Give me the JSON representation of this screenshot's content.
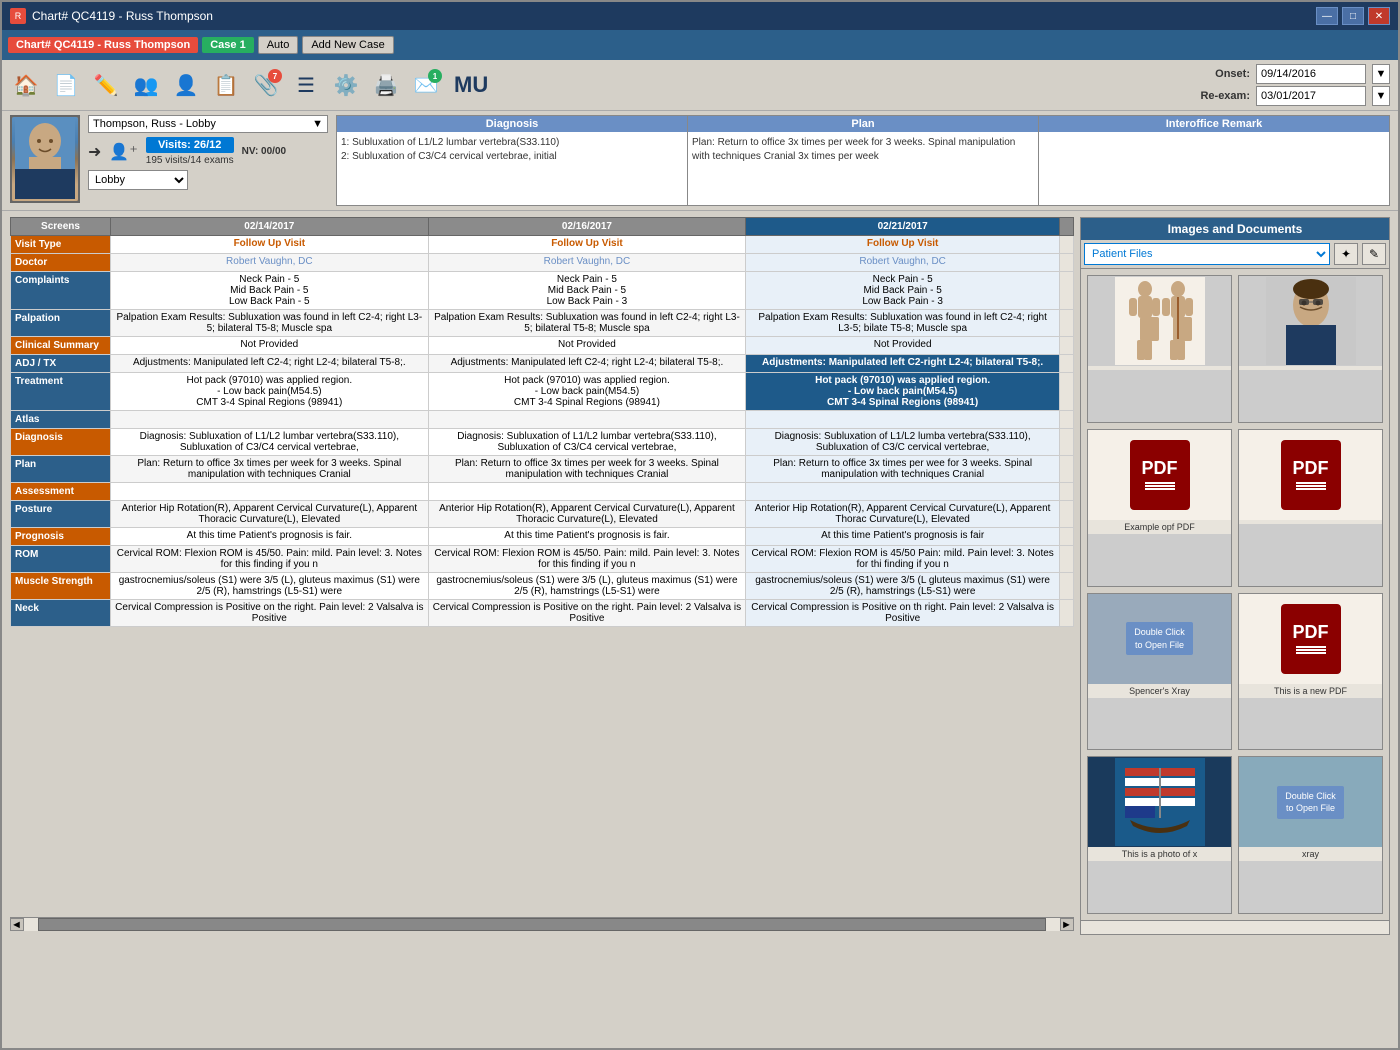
{
  "titleBar": {
    "title": "Chart# QC4119 - Russ Thompson",
    "iconText": "R",
    "minimizeLabel": "—",
    "maximizeLabel": "□",
    "closeLabel": "✕"
  },
  "menuBar": {
    "chartTag": "Chart# QC4119 - Russ Thompson",
    "caseTag": "Case 1",
    "autoItem": "Auto",
    "addNewCase": "Add New Case"
  },
  "toolbar": {
    "badge1": "7",
    "badge2": "1",
    "muLabel": "MU",
    "onsetLabel": "Onset:",
    "onsetValue": "09/14/2016",
    "reexamLabel": "Re-exam:",
    "reexamValue": "03/01/2017"
  },
  "patientBar": {
    "patientName": "Thompson, Russ - Lobby",
    "diagnosisHeader": "Diagnosis",
    "planHeader": "Plan",
    "interofficeHeader": "Interoffice Remark",
    "visitsLabel": "Visits: 26/12",
    "examsLabel": "195 visits/14 exams",
    "nvLabel": "NV: 00/00",
    "lobbyValue": "Lobby",
    "diagnosis1": "1: Subluxation of L1/L2 lumbar vertebra(S33.110)",
    "diagnosis2": "2: Subluxation of C3/C4 cervical vertebrae, initial",
    "plan": "Plan: Return to office 3x times per week for 3 weeks.  Spinal manipulation with techniques Cranial 3x times per week"
  },
  "tableHeader": {
    "screens": "Screens",
    "col1": "02/14/2017",
    "col2": "02/16/2017",
    "col3": "02/21/2017"
  },
  "tableRows": [
    {
      "label": "Visit Type",
      "labelStyle": "orange",
      "col1": "Follow Up Visit",
      "col2": "Follow Up Visit",
      "col3": "Follow Up Visit",
      "type": "visitType"
    },
    {
      "label": "Doctor",
      "labelStyle": "orange",
      "col1": "Robert Vaughn, DC",
      "col2": "Robert Vaughn, DC",
      "col3": "Robert Vaughn, DC",
      "type": "doctor"
    },
    {
      "label": "Complaints",
      "labelStyle": "blue",
      "col1": "Neck Pain - 5\nMid Back Pain - 5\nLow Back Pain - 5",
      "col2": "Neck Pain - 5\nMid Back Pain - 5\nLow Back Pain - 3",
      "col3": "Neck Pain - 5\nMid Back Pain - 5\nLow Back Pain - 3",
      "type": "normal"
    },
    {
      "label": "Palpation",
      "labelStyle": "blue",
      "col1": "Palpation Exam Results: Subluxation was found in left C2-4; right L3-5; bilateral T5-8;  Muscle spa",
      "col2": "Palpation Exam Results: Subluxation was found in left C2-4; right L3-5; bilateral T5-8;  Muscle spa",
      "col3": "Palpation Exam Results: Subluxation was found in left C2-4; right L3-5; bilate T5-8;  Muscle spa",
      "type": "normal"
    },
    {
      "label": "Clinical Summary",
      "labelStyle": "orange",
      "col1": "Not Provided",
      "col2": "Not Provided",
      "col3": "Not Provided",
      "type": "normal"
    },
    {
      "label": "ADJ / TX",
      "labelStyle": "blue",
      "col1": "Adjustments: Manipulated left C2-4; right L2-4; bilateral T5-8;.",
      "col2": "Adjustments: Manipulated left C2-4; right L2-4; bilateral T5-8;.",
      "col3": "Adjustments: Manipulated left C2-right L2-4; bilateral T5-8;.",
      "type": "highlighted"
    },
    {
      "label": "Treatment",
      "labelStyle": "blue",
      "col1": "Hot pack (97010) was applied region.\n - Low back pain(M54.5)\nCMT 3-4 Spinal Regions (98941)",
      "col2": "Hot pack (97010) was applied region.\n - Low back pain(M54.5)\nCMT 3-4 Spinal Regions (98941)",
      "col3": "Hot pack (97010) was applied region.\n - Low back pain(M54.5)\nCMT 3-4 Spinal Regions (98941)",
      "type": "highlighted"
    },
    {
      "label": "Atlas",
      "labelStyle": "blue",
      "col1": "",
      "col2": "",
      "col3": "",
      "type": "normal"
    },
    {
      "label": "Diagnosis",
      "labelStyle": "orange",
      "col1": "Diagnosis: Subluxation of L1/L2 lumbar vertebra(S33.110), Subluxation of C3/C4 cervical vertebrae,",
      "col2": "Diagnosis: Subluxation of L1/L2 lumbar vertebra(S33.110), Subluxation of C3/C4 cervical vertebrae,",
      "col3": "Diagnosis: Subluxation of L1/L2 lumba vertebra(S33.110), Subluxation of C3/C cervical vertebrae,",
      "type": "normal"
    },
    {
      "label": "Plan",
      "labelStyle": "blue",
      "col1": "Plan: Return to office 3x times per week for 3 weeks. Spinal manipulation with techniques Cranial",
      "col2": "Plan: Return to office 3x times per week for 3 weeks. Spinal manipulation with techniques Cranial",
      "col3": "Plan: Return to office 3x times per wee for 3 weeks. Spinal manipulation with techniques Cranial",
      "type": "normal"
    },
    {
      "label": "Assessment",
      "labelStyle": "orange",
      "col1": "",
      "col2": "",
      "col3": "",
      "type": "normal"
    },
    {
      "label": "Posture",
      "labelStyle": "blue",
      "col1": "Anterior Hip Rotation(R), Apparent Cervical Curvature(L), Apparent Thoracic Curvature(L), Elevated",
      "col2": "Anterior Hip Rotation(R), Apparent Cervical Curvature(L), Apparent Thoracic Curvature(L), Elevated",
      "col3": "Anterior Hip Rotation(R), Apparent Cervical Curvature(L), Apparent Thorac Curvature(L), Elevated",
      "type": "normal"
    },
    {
      "label": "Prognosis",
      "labelStyle": "orange",
      "col1": "At this time Patient's prognosis is fair.",
      "col2": "At this time Patient's prognosis is fair.",
      "col3": "At this time Patient's prognosis is fair",
      "type": "normal"
    },
    {
      "label": "ROM",
      "labelStyle": "blue",
      "col1": "Cervical ROM: Flexion ROM is 45/50. Pain: mild. Pain level: 3.  Notes for this finding if you n",
      "col2": "Cervical ROM: Flexion ROM is 45/50. Pain: mild. Pain level: 3.  Notes for this finding if you n",
      "col3": "Cervical ROM: Flexion ROM is 45/50 Pain: mild. Pain level: 3.  Notes for thi finding if you n",
      "type": "normal"
    },
    {
      "label": "Muscle Strength",
      "labelStyle": "orange",
      "col1": "gastrocnemius/soleus (S1) were 3/5 (L), gluteus maximus (S1) were 2/5 (R), hamstrings (L5-S1)  were",
      "col2": "gastrocnemius/soleus (S1) were 3/5 (L), gluteus maximus (S1) were 2/5 (R), hamstrings (L5-S1)  were",
      "col3": "gastrocnemius/soleus (S1) were 3/5 (L gluteus maximus (S1) were 2/5 (R), hamstrings (L5-S1)  were",
      "type": "normal"
    },
    {
      "label": "Neck",
      "labelStyle": "blue",
      "col1": "Cervical Compression is Positive on the right.  Pain level: 2 Valsalva is Positive",
      "col2": "Cervical Compression is Positive on the right.  Pain level: 2 Valsalva is Positive",
      "col3": "Cervical Compression is Positive on th right.  Pain level: 2 Valsalva is Positive",
      "type": "normal"
    }
  ],
  "imagesPanel": {
    "header": "Images and Documents",
    "dropdownValue": "Patient Files",
    "thumbs": [
      {
        "type": "anatomy",
        "label": ""
      },
      {
        "type": "photo",
        "label": ""
      },
      {
        "type": "pdf",
        "label": "Example opf PDF"
      },
      {
        "type": "pdf",
        "label": ""
      },
      {
        "type": "doubleclick",
        "label": "Spencer's Xray"
      },
      {
        "type": "pdf-new",
        "label": "This is a new PDF"
      },
      {
        "type": "flag",
        "label": "This is a photo of x"
      },
      {
        "type": "xray",
        "label": "xray"
      }
    ]
  }
}
